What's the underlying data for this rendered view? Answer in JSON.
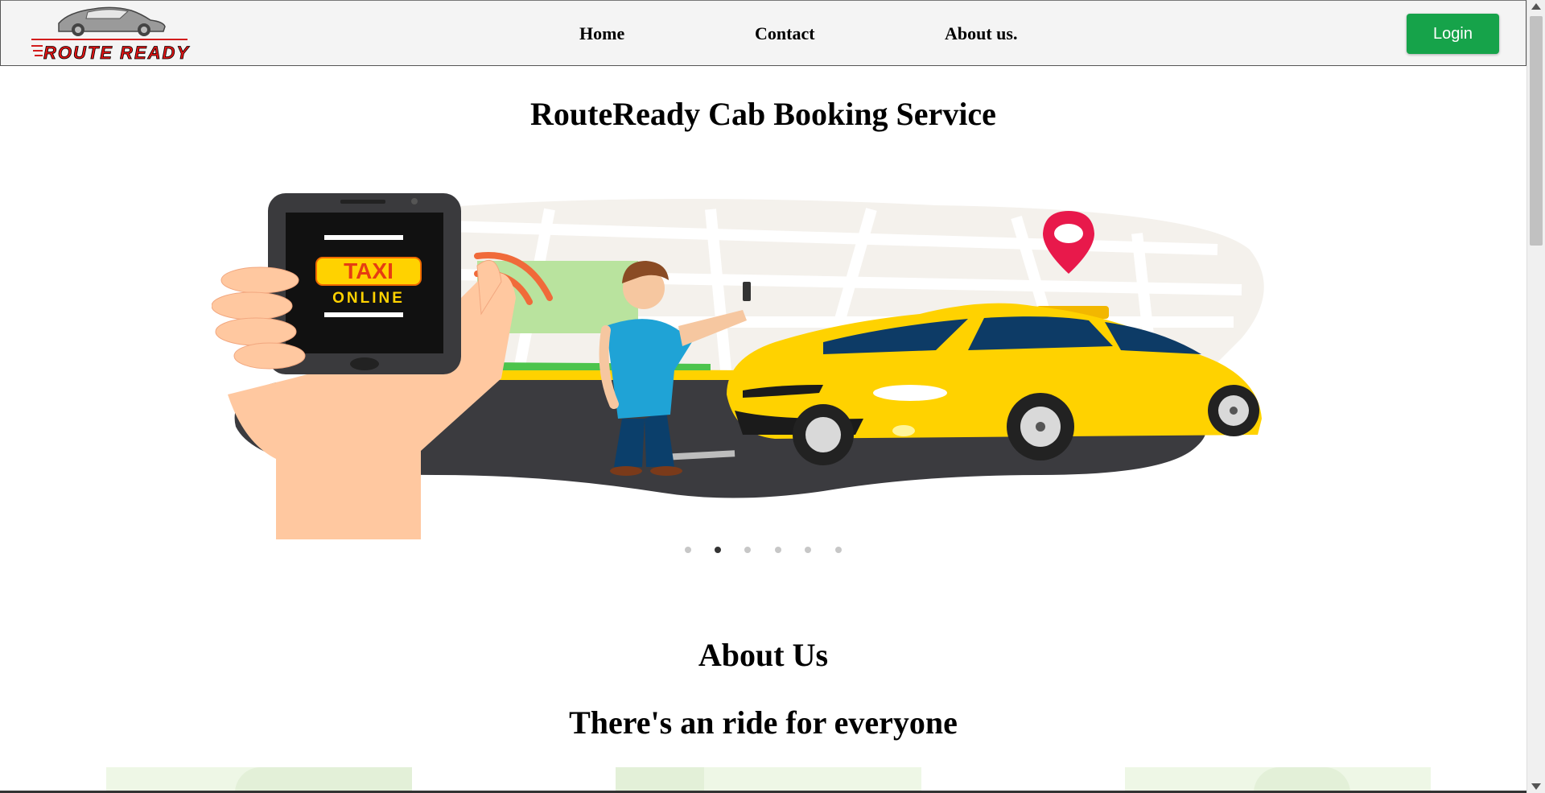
{
  "brand": {
    "logo_text": "ROUTE READY"
  },
  "nav": {
    "home": "Home",
    "contact": "Contact",
    "about": "About us.",
    "login": "Login"
  },
  "hero": {
    "title": "RouteReady Cab Booking Service",
    "phone_line1": "TAXI",
    "phone_line2": "ONLINE",
    "carousel": {
      "slide_count": 6,
      "active_index": 1
    }
  },
  "about": {
    "title": "About Us",
    "subtitle": "There's an ride for everyone"
  },
  "colors": {
    "accent_green": "#16a34a",
    "taxi_yellow": "#ffd200",
    "pin_red": "#e8194b"
  }
}
